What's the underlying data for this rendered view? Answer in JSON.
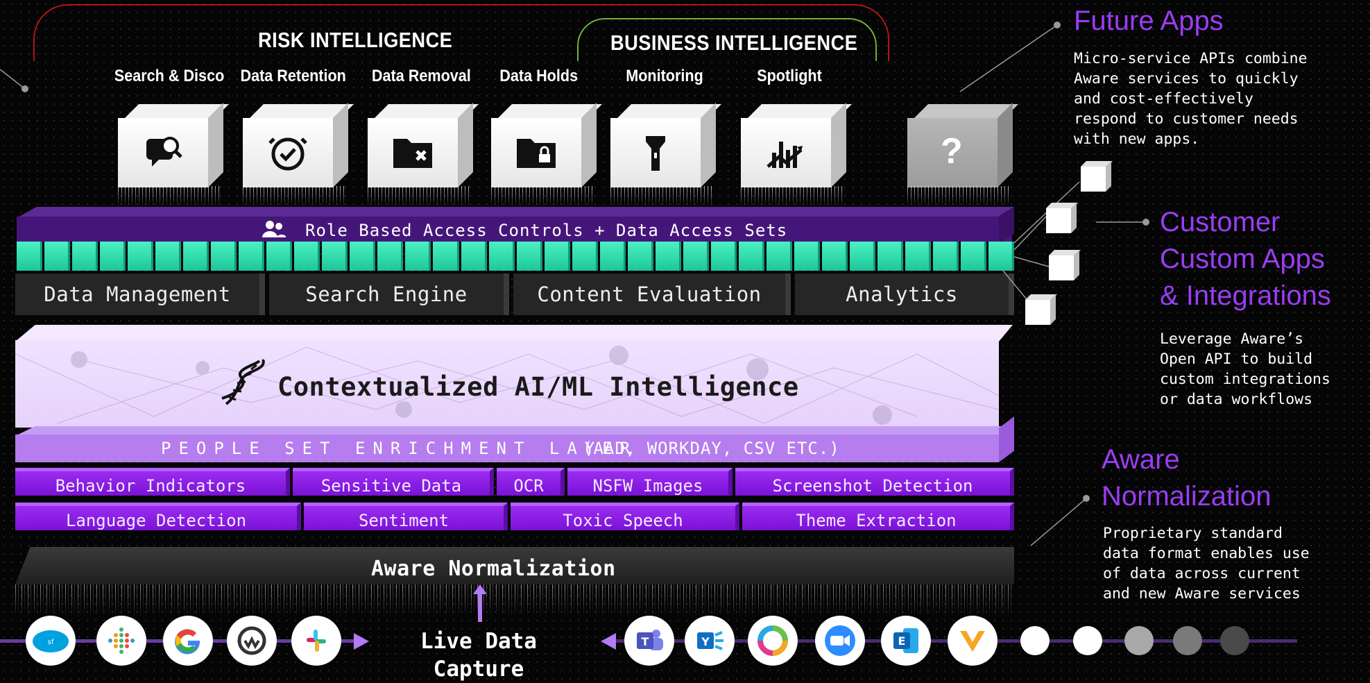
{
  "risk_title": "RISK INTELLIGENCE",
  "business_title": "BUSINESS INTELLIGENCE",
  "apps": [
    {
      "label": "Search & Disco",
      "icon": "search-chat-icon"
    },
    {
      "label": "Data Retention",
      "icon": "alarm-clock-check-icon"
    },
    {
      "label": "Data Removal",
      "icon": "folder-x-icon"
    },
    {
      "label": "Data Holds",
      "icon": "folder-lock-icon"
    },
    {
      "label": "Monitoring",
      "icon": "flashlight-icon"
    },
    {
      "label": "Spotlight",
      "icon": "chart-trend-icon"
    },
    {
      "label": "?",
      "icon": "question-icon"
    }
  ],
  "rbac_label": "Role Based Access Controls + Data Access Sets",
  "services": [
    "Data Management",
    "Search Engine",
    "Content Evaluation",
    "Analytics"
  ],
  "ai_label": "Contextualized AI/ML Intelligence",
  "people_layer": {
    "label": "PEOPLE SET ENRICHMENT LAYER",
    "sources": "(AAD, WORKDAY, CSV ETC.)"
  },
  "tiles_row1": [
    "Behavior Indicators",
    "Sensitive Data",
    "OCR",
    "NSFW Images",
    "Screenshot Detection"
  ],
  "tiles_row2": [
    "Language Detection",
    "Sentiment",
    "Toxic Speech",
    "Theme Extraction"
  ],
  "normalization_label": "Aware Normalization",
  "live_capture": {
    "line1": "Live Data",
    "line2": "Capture"
  },
  "left_logos": [
    "salesforce",
    "workplace-dots",
    "google",
    "workplace-chat",
    "slack"
  ],
  "right_logos": [
    "teams",
    "yammer",
    "webex",
    "zoom",
    "exchange",
    "vertex"
  ],
  "panels": {
    "future": {
      "heading": "Future Apps",
      "desc": "Micro-service APIs combine\nAware services to quickly\nand cost-effectively\nrespond to customer needs\nwith new apps."
    },
    "custom": {
      "heading1": "Customer",
      "heading2": "Custom Apps",
      "heading3": "& Integrations",
      "desc": "Leverage Aware’s\nOpen API to build\ncustom integrations\nor data workflows"
    },
    "normalization": {
      "heading1": "Aware",
      "heading2": "Normalization",
      "desc": "Proprietary standard\ndata format enables use\nof data across current\nand new Aware services"
    }
  },
  "colors": {
    "accent_purple": "#9b3cf5",
    "teal": "#2ee6b4",
    "risk_red": "#b0141a",
    "business_green": "#6fb13a"
  }
}
